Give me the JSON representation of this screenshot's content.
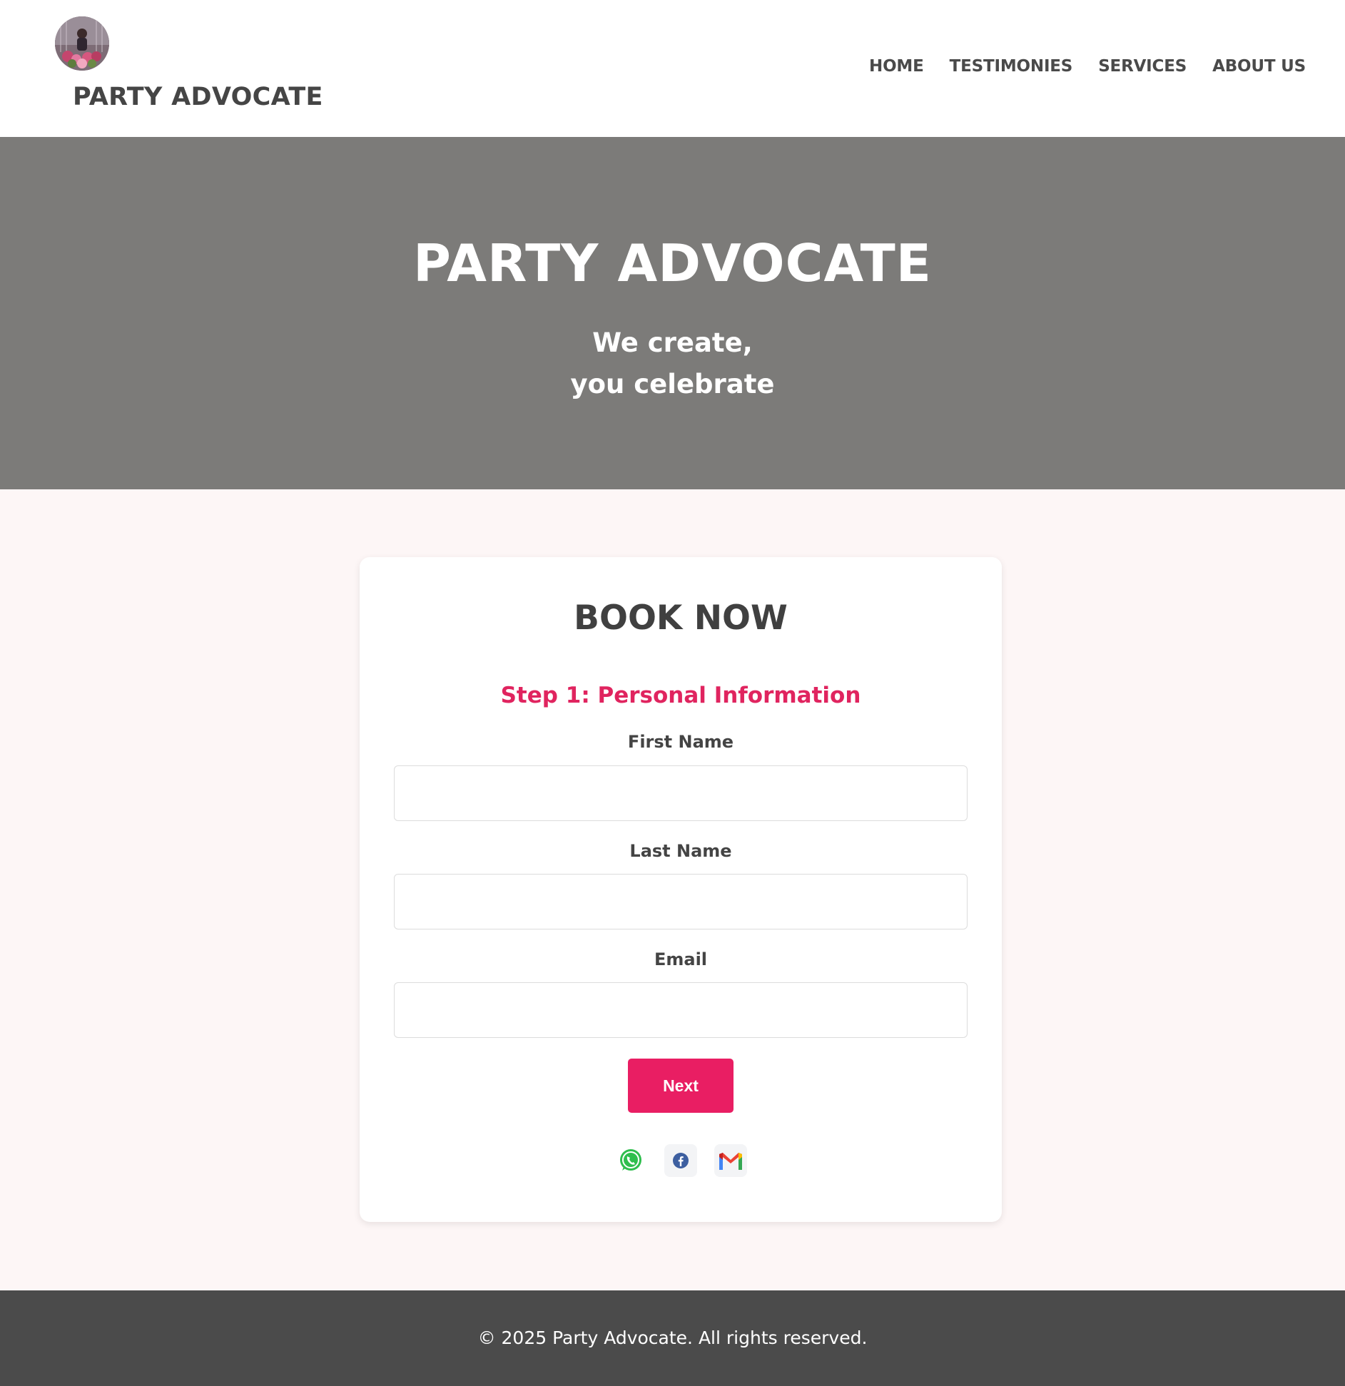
{
  "header": {
    "brand": "PARTY ADVOCATE",
    "nav": [
      "HOME",
      "TESTIMONIES",
      "SERVICES",
      "ABOUT US"
    ]
  },
  "hero": {
    "title": "PARTY ADVOCATE",
    "subtitle_line1": "We create,",
    "subtitle_line2": "you celebrate"
  },
  "booking": {
    "title": "BOOK NOW",
    "step_title": "Step 1: Personal Information",
    "fields": [
      {
        "label": "First Name",
        "value": ""
      },
      {
        "label": "Last Name",
        "value": ""
      },
      {
        "label": "Email",
        "value": ""
      }
    ],
    "next_label": "Next",
    "social_icons": [
      "whatsapp-icon",
      "facebook-icon",
      "gmail-icon"
    ]
  },
  "footer": {
    "copyright": "© 2025 Party Advocate. All rights reserved."
  },
  "colors": {
    "accent": "#e91e63",
    "hero_bg": "#7c7b79",
    "footer_bg": "#4b4b4b",
    "page_bg": "#fdf6f6"
  }
}
